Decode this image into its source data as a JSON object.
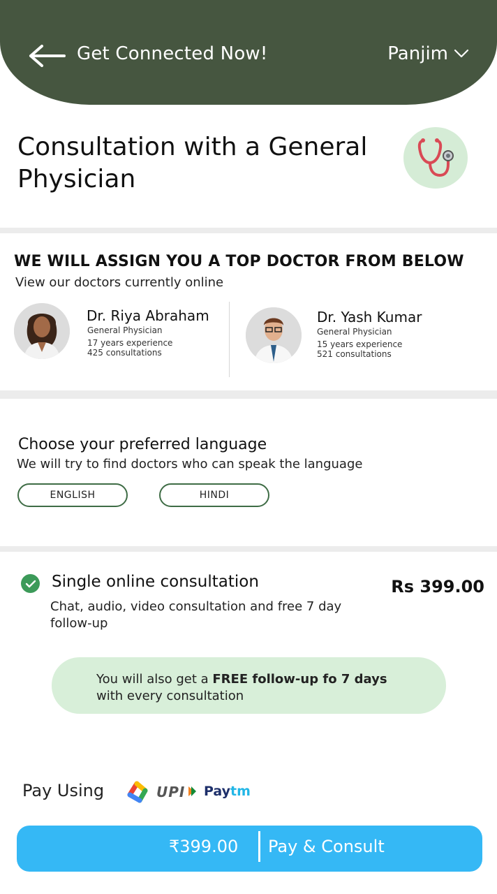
{
  "header": {
    "back_icon": "arrow-left-icon",
    "title": "Get Connected Now!",
    "city": "Panjim",
    "city_icon": "chevron-down-icon"
  },
  "service": {
    "title": "Consultation with a General Physician",
    "icon": "stethoscope-icon"
  },
  "doctors_section": {
    "heading": "WE WILL ASSIGN YOU A TOP DOCTOR FROM BELOW",
    "subheading": "View our doctors currently online",
    "doctors": [
      {
        "name": "Dr. Riya Abraham",
        "specialty": "General Physician",
        "experience": "17 years experience",
        "consultations": "425 consultations"
      },
      {
        "name": "Dr. Yash Kumar",
        "specialty": "General Physician",
        "experience": "15 years experience",
        "consultations": "521 consultations"
      }
    ]
  },
  "language": {
    "heading": "Choose your preferred language",
    "subheading": "We will try to find doctors who can speak the language",
    "options": [
      "ENGLISH",
      "HINDI"
    ]
  },
  "plan": {
    "check_icon": "check-circle-icon",
    "title": "Single online consultation",
    "price": "Rs 399.00",
    "description": "Chat, audio, video consultation and free 7 day follow-up",
    "free_prefix": "You will also get a ",
    "free_bold": "FREE follow-up fo 7 days",
    "free_suffix": "with every consultation"
  },
  "payment": {
    "pay_using": "Pay Using",
    "methods": [
      "gpay-icon",
      "UPI",
      "Paytm"
    ],
    "upi_label": "UPI",
    "paytm_pay": "Pay",
    "paytm_tm": "tm",
    "amount": "₹399.00",
    "button_label": "Pay & Consult"
  },
  "colors": {
    "header_bg": "#465640",
    "accent_green": "#3c9a59",
    "light_green": "#d8efd9",
    "pay_button": "#35b8f5"
  }
}
